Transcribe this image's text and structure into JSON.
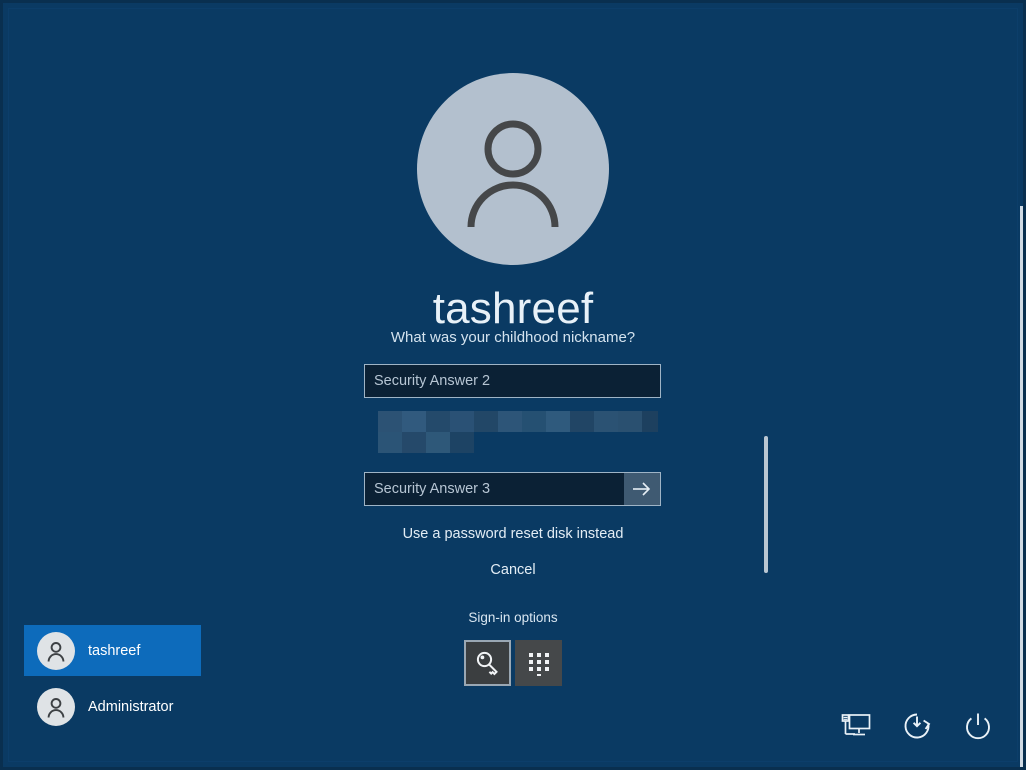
{
  "screen": {
    "background_color": "#0a3a63",
    "accent_color": "#0d6bbb"
  },
  "login": {
    "avatar_icon": "person-avatar-icon",
    "username": "tashreef",
    "security_question": "What was your childhood nickname?",
    "fields": [
      {
        "name": "security-answer-2",
        "placeholder": "Security Answer 2",
        "value": ""
      },
      {
        "name": "security-answer-3",
        "placeholder": "Security Answer 3",
        "value": ""
      }
    ],
    "submit_icon": "arrow-right-icon",
    "redacted_note": "pixelated-redacted-answer",
    "links": [
      {
        "name": "password-reset-disk-link",
        "label": "Use a password reset disk instead"
      },
      {
        "name": "cancel-link",
        "label": "Cancel"
      }
    ],
    "signin_options_label": "Sign-in options",
    "signin_options": [
      {
        "name": "password-option",
        "icon": "key-icon",
        "selected": true
      },
      {
        "name": "pin-option",
        "icon": "keypad-icon",
        "selected": false
      }
    ]
  },
  "users": [
    {
      "name": "tashreef",
      "icon": "person-icon",
      "active": true
    },
    {
      "name": "Administrator",
      "icon": "person-icon",
      "active": false
    }
  ],
  "system_icons": [
    {
      "name": "network-icon",
      "label": "Network"
    },
    {
      "name": "ease-of-access-icon",
      "label": "Ease of Access"
    },
    {
      "name": "power-icon",
      "label": "Power"
    }
  ]
}
